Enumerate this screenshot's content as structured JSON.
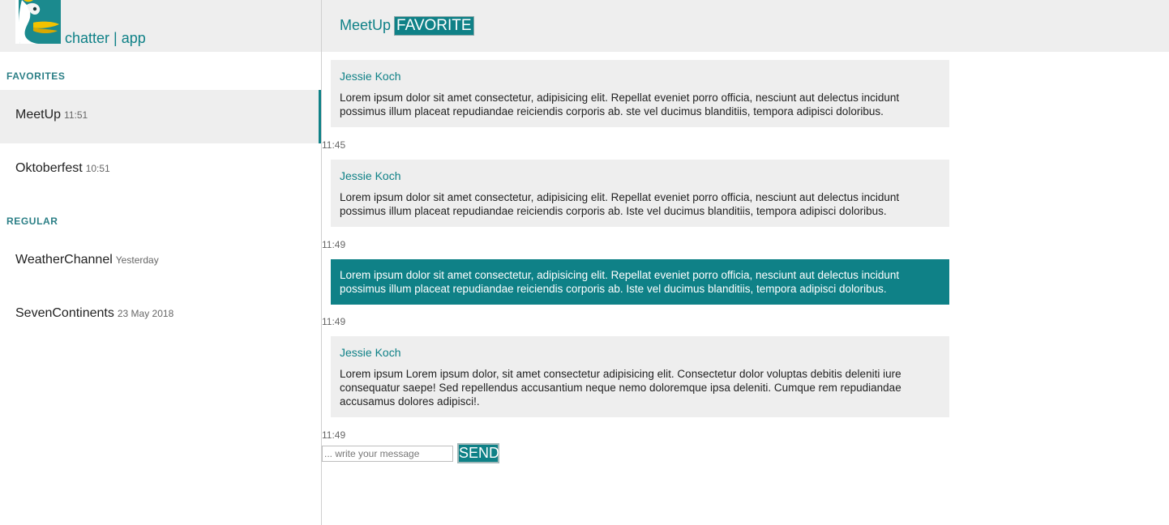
{
  "brand": {
    "name": "chatter | app",
    "logo_icon": "duck-logo-icon"
  },
  "colors": {
    "accent": "#0f8187",
    "panel": "#eeeeee"
  },
  "sidebar": {
    "favorites_title": "FAVORITES",
    "regular_title": "REGULAR",
    "favorites": [
      {
        "name": "MeetUp",
        "time": "11:51",
        "active": true
      },
      {
        "name": "Oktoberfest",
        "time": "10:51",
        "active": false
      }
    ],
    "regular": [
      {
        "name": "WeatherChannel",
        "time": "Yesterday"
      },
      {
        "name": "SevenContinents",
        "time": "23 May 2018"
      }
    ]
  },
  "header": {
    "title": "MeetUp",
    "favorite_label": "FAVORITE"
  },
  "messages": [
    {
      "author": "Jessie Koch",
      "text": "Lorem ipsum dolor sit amet consectetur, adipisicing elit. Repellat eveniet porro officia, nesciunt aut delectus incidunt possimus illum placeat repudiandae reiciendis corporis ab. ste vel ducimus blanditiis, tempora adipisci doloribus.",
      "time": "11:45",
      "own": false
    },
    {
      "author": "Jessie Koch",
      "text": "Lorem ipsum dolor sit amet consectetur, adipisicing elit. Repellat eveniet porro officia, nesciunt aut delectus incidunt possimus illum placeat repudiandae reiciendis corporis ab. Iste vel ducimus blanditiis, tempora adipisci doloribus.",
      "time": "11:49",
      "own": false
    },
    {
      "author": "",
      "text": "Lorem ipsum dolor sit amet consectetur, adipisicing elit. Repellat eveniet porro officia, nesciunt aut delectus incidunt possimus illum placeat repudiandae reiciendis corporis ab. Iste vel ducimus blanditiis, tempora adipisci doloribus.",
      "time": "11:49",
      "own": true
    },
    {
      "author": "Jessie Koch",
      "text": "Lorem ipsum Lorem ipsum dolor, sit amet consectetur adipisicing elit. Consectetur dolor voluptas debitis deleniti iure consequatur saepe! Sed repellendus accusantium neque nemo doloremque ipsa deleniti. Cumque rem repudiandae accusamus dolores adipisci!.",
      "time": "11:49",
      "own": false
    }
  ],
  "composer": {
    "placeholder": "... write your message",
    "send_label": "SEND"
  }
}
